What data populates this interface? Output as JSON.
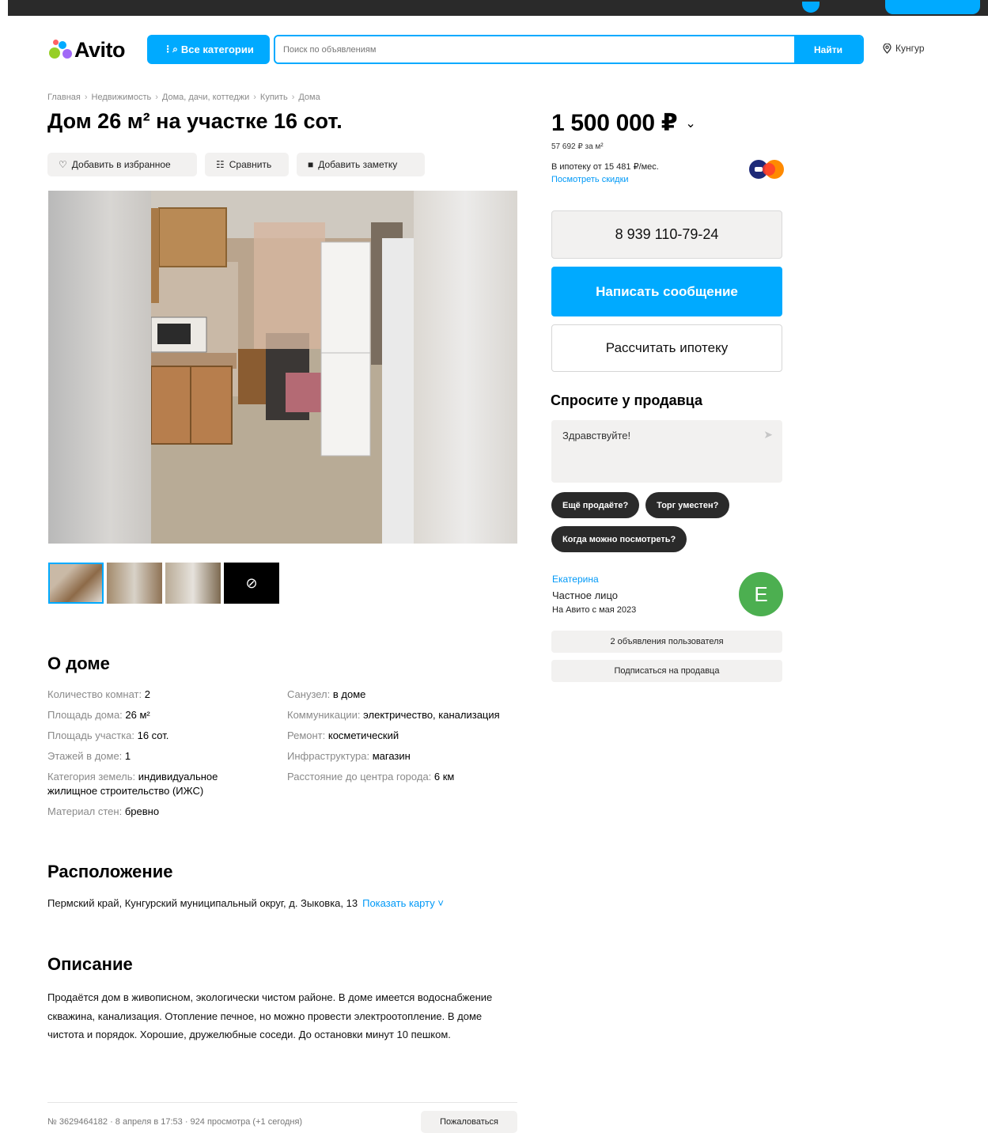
{
  "header": {
    "logo_text": "Avito",
    "categories_label": "Все категории",
    "search_placeholder": "Поиск по объявлениям",
    "search_button": "Найти",
    "location": "Кунгур"
  },
  "breadcrumbs": [
    "Главная",
    "Недвижимость",
    "Дома, дачи, коттеджи",
    "Купить",
    "Дома"
  ],
  "listing": {
    "title": "Дом 26 м² на участке 16 сот.",
    "actions": {
      "favorite": "Добавить в избранное",
      "compare": "Сравнить",
      "note": "Добавить заметку"
    }
  },
  "about": {
    "title": "О доме",
    "left": [
      {
        "key": "Количество комнат: ",
        "value": "2"
      },
      {
        "key": "Площадь дома: ",
        "value": "26 м²"
      },
      {
        "key": "Площадь участка: ",
        "value": "16 сот."
      },
      {
        "key": "Этажей в доме: ",
        "value": "1"
      },
      {
        "key": "Категория земель: ",
        "value": "индивидуальное жилищное строительство (ИЖС)"
      },
      {
        "key": "Материал стен: ",
        "value": "бревно"
      }
    ],
    "right": [
      {
        "key": "Санузел: ",
        "value": "в доме"
      },
      {
        "key": "Коммуникации: ",
        "value": "электричество, канализация"
      },
      {
        "key": "Ремонт: ",
        "value": "косметический"
      },
      {
        "key": "Инфраструктура: ",
        "value": "магазин"
      },
      {
        "key": "Расстояние до центра города: ",
        "value": "6 км"
      }
    ]
  },
  "location_section": {
    "title": "Расположение",
    "address": "Пермский край, Кунгурский муниципальный округ, д. Зыковка, 13",
    "show_map": "Показать карту ˅"
  },
  "description": {
    "title": "Описание",
    "text": "Продаётся дом в живописном, экологически чистом районе. В доме имеется водоснабжение скважина, канализация. Отопление печное, но можно провести электроотопление. В доме чистота и порядок. Хорошие, дружелюбные соседи. До остановки минут 10 пешком."
  },
  "footer": {
    "meta": "№ 3629464182 · 8 апреля в 17:53 · 924 просмотра (+1 сегодня)",
    "report": "Пожаловаться"
  },
  "sidebar": {
    "price": "1 500 000 ₽",
    "price_per_m2": "57 692 ₽ за м²",
    "mortgage": "В ипотеку от 15 481 ₽/мес.",
    "discounts_link": "Посмотреть скидки",
    "phone": "8 939 110-79-24",
    "write_message": "Написать сообщение",
    "calc_mortgage": "Рассчитать ипотеку",
    "ask_title": "Спросите у продавца",
    "ask_placeholder": "Здравствуйте!",
    "chips": [
      "Ещё продаёте?",
      "Торг уместен?",
      "Когда можно посмотреть?"
    ],
    "seller": {
      "name": "Екатерина",
      "type": "Частное лицо",
      "since": "На Авито с мая 2023",
      "initial": "Е",
      "listings_btn": "2 объявления пользователя",
      "subscribe_btn": "Подписаться на продавца"
    }
  },
  "colors": {
    "accent": "#00aaff",
    "link": "#0099f7",
    "dark_chip": "#2a2a2a",
    "avatar": "#4caf50"
  }
}
